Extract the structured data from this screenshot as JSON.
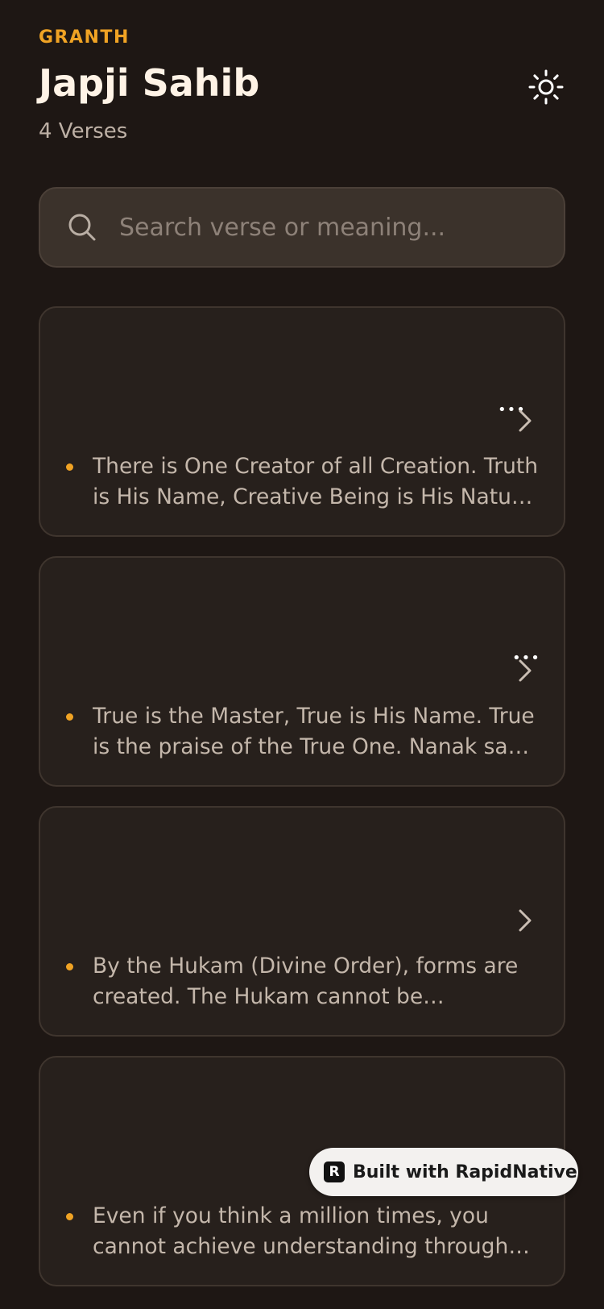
{
  "header": {
    "eyebrow": "GRANTH",
    "title": "Japji Sahib",
    "subtitle": "4 Verses"
  },
  "theme_toggle": {
    "icon": "sun-icon"
  },
  "search": {
    "placeholder": "Search verse or meaning...",
    "value": "",
    "icon": "search-icon"
  },
  "verses": [
    {
      "meaning": "There is One Creator of all Creation. Truth is His Name, Creative Being is His Nature. Without fear, without hatred, timeless image, beyond birth, self-existent, by Guru's grace.",
      "dots": "•••"
    },
    {
      "meaning": "True is the Master, True is His Name. True is the praise of the True One. Nanak says, He is, was, and shall ever be True.",
      "dots": "•••"
    },
    {
      "meaning": "By the Hukam (Divine Order), forms are created. The Hukam cannot be described.",
      "dots": ""
    },
    {
      "meaning": "Even if you think a million times, you cannot achieve understanding through thought.",
      "dots": ""
    }
  ],
  "badge": {
    "label": "Built with RapidNative",
    "logo_letter": "R"
  },
  "colors": {
    "background": "#1e1714",
    "card": "#27201c",
    "accent": "#f0a324",
    "title": "#fff3e6",
    "muted": "#bdb0a5"
  }
}
